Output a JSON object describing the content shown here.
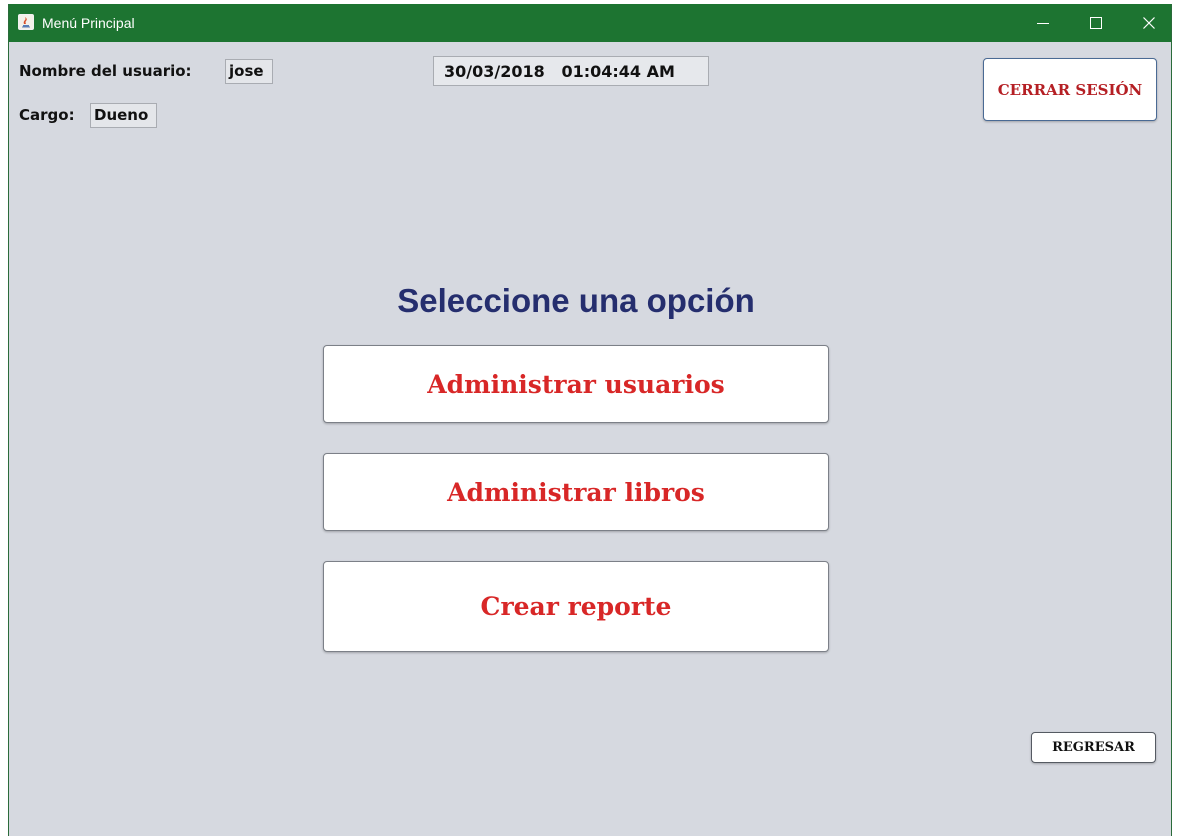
{
  "window": {
    "title": "Menú Principal",
    "titlebar_color": "#1d7431"
  },
  "user": {
    "name_label": "Nombre del usuario:",
    "name_value": "jose",
    "role_label": "Cargo:",
    "role_value": "Dueno"
  },
  "datetime": {
    "date": "30/03/2018",
    "time": "01:04:44 AM"
  },
  "logout_button": {
    "label": "CERRAR SESIÓN"
  },
  "main": {
    "heading": "Seleccione una opción",
    "options": [
      {
        "label": "Administrar usuarios"
      },
      {
        "label": "Administrar libros"
      },
      {
        "label": "Crear reporte"
      }
    ]
  },
  "back_button": {
    "label": "REGRESAR"
  },
  "colors": {
    "background": "#d6d9e0",
    "option_text": "#d82727",
    "heading_text": "#252e6e"
  }
}
